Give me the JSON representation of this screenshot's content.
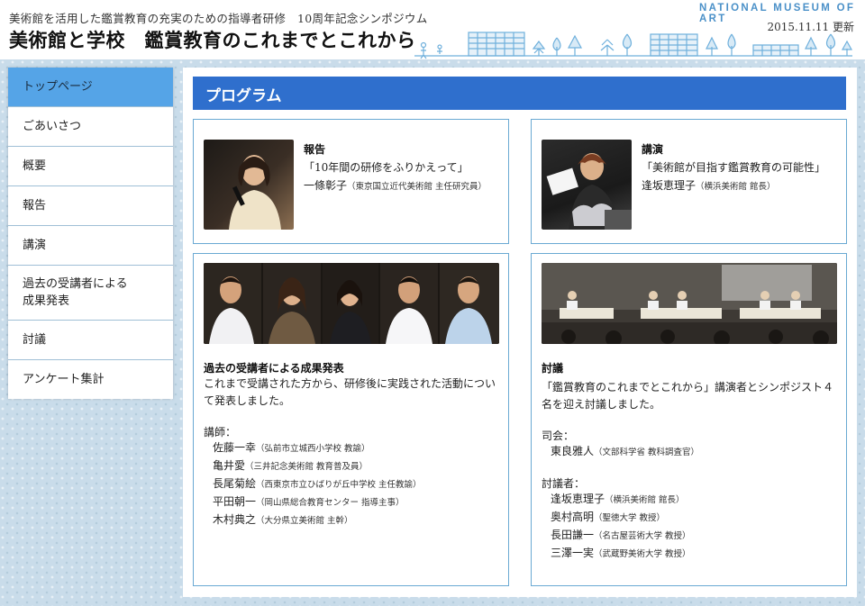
{
  "header": {
    "subtitle": "美術館を活用した鑑賞教育の充実のための指導者研修　10周年記念シンポジウム",
    "title": "美術館と学校　鑑賞教育のこれまでとこれから",
    "museum_name": "NATIONAL MUSEUM OF ART",
    "update_date": "2015.11.11 更新"
  },
  "sidebar": {
    "items": [
      {
        "label": "トップページ",
        "active": true
      },
      {
        "label": "ごあいさつ"
      },
      {
        "label": "概要"
      },
      {
        "label": "報告"
      },
      {
        "label": "講演"
      },
      {
        "label": "過去の受講者による\n成果発表"
      },
      {
        "label": "討議"
      },
      {
        "label": "アンケート集計"
      }
    ]
  },
  "main": {
    "heading": "プログラム",
    "report": {
      "label": "報告",
      "title": "「10年間の研修をふりかえって」",
      "name": "一條彰子",
      "affiliation": "（東京国立近代美術館 主任研究員）"
    },
    "lecture": {
      "label": "講演",
      "title": "「美術館が目指す鑑賞教育の可能性」",
      "name": "逢坂恵理子",
      "affiliation": "（横浜美術館 館長）"
    },
    "presentations": {
      "heading": "過去の受講者による成果発表",
      "description": "これまで受講された方から、研修後に実践された活動について発表しました。",
      "speakers_label": "講師：",
      "speakers": [
        {
          "name": "佐藤一幸",
          "affiliation": "（弘前市立城西小学校 教諭）"
        },
        {
          "name": "亀井愛",
          "affiliation": "（三井記念美術館 教育普及員）"
        },
        {
          "name": "長尾菊絵",
          "affiliation": "（西東京市立ひばりが丘中学校 主任教諭）"
        },
        {
          "name": "平田朝一",
          "affiliation": "（岡山県総合教育センター 指導主事）"
        },
        {
          "name": "木村典之",
          "affiliation": "（大分県立美術館 主幹）"
        }
      ]
    },
    "discussion": {
      "heading": "討議",
      "description": "「鑑賞教育のこれまでとこれから」講演者とシンポジスト４名を迎え討議しました。",
      "moderator_label": "司会：",
      "moderator": {
        "name": "東良雅人",
        "affiliation": "（文部科学省 教科調査官）"
      },
      "panelists_label": "討議者：",
      "panelists": [
        {
          "name": "逢坂恵理子",
          "affiliation": "（横浜美術館 館長）"
        },
        {
          "name": "奥村高明",
          "affiliation": "（聖徳大学 教授）"
        },
        {
          "name": "長田謙一",
          "affiliation": "（名古屋芸術大学 教授）"
        },
        {
          "name": "三澤一実",
          "affiliation": "（武蔵野美術大学 教授）"
        }
      ]
    }
  },
  "colors": {
    "accent": "#2f6fcd",
    "nav_active": "#55a4e7",
    "card_border": "#6aa9d3",
    "museum_name": "#4a90c8"
  },
  "icons": [
    "skyline-illustration"
  ]
}
